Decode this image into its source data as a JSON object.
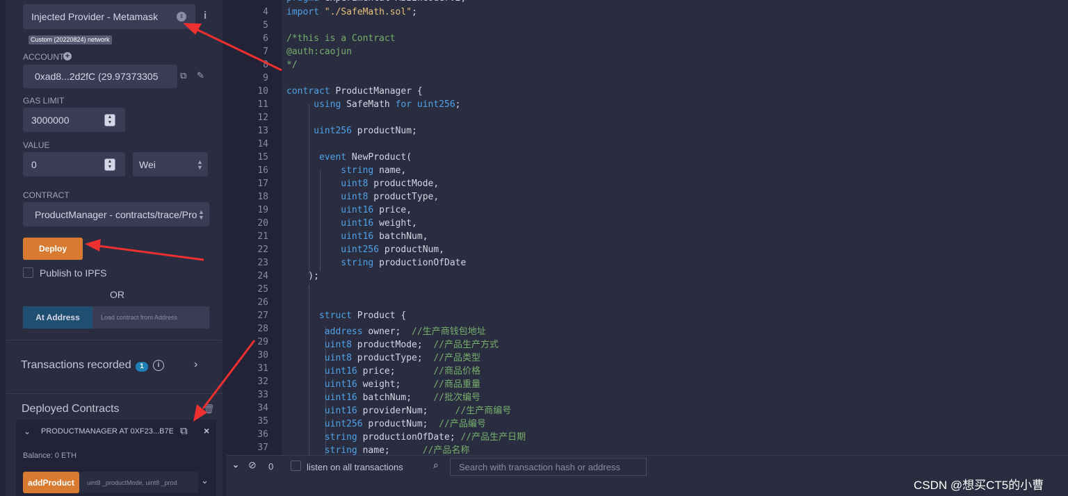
{
  "left": {
    "environment": "Injected Provider - Metamask",
    "network_badge": "Custom (20220824) network",
    "account_label": "ACCOUNT",
    "account_value": "0xad8...2d2fC (29.97373305",
    "gas_label": "GAS LIMIT",
    "gas_value": "3000000",
    "value_label": "VALUE",
    "value_amount": "0",
    "value_unit": "Wei",
    "contract_label": "CONTRACT",
    "contract_value": "ProductManager - contracts/trace/Pro",
    "deploy": "Deploy",
    "publish_ipfs": "Publish to IPFS",
    "or": "OR",
    "at_address": "At Address",
    "load_placeholder": "Load contract from Address",
    "tx_recorded": "Transactions recorded",
    "tx_count": "1",
    "deployed_title": "Deployed Contracts",
    "instance_name": "PRODUCTMANAGER AT 0XF23...B7E",
    "balance": "Balance: 0 ETH",
    "add_product": "addProduct",
    "add_product_params": "uint8 _productMode, uint8 _prod"
  },
  "editor": {
    "line_numbers": [
      "4",
      "5",
      "6",
      "7",
      "8",
      "9",
      "10",
      "11",
      "12",
      "13",
      "14",
      "15",
      "16",
      "17",
      "18",
      "19",
      "20",
      "21",
      "22",
      "23",
      "24",
      "25",
      "26",
      "27",
      "28",
      "29",
      "30",
      "31",
      "32",
      "33",
      "34",
      "35",
      "36",
      "37"
    ]
  },
  "terminal": {
    "count": "0",
    "listen_label": "listen on all transactions",
    "search_placeholder": "Search with transaction hash or address"
  },
  "watermark": "CSDN @想买CT5的小曹"
}
